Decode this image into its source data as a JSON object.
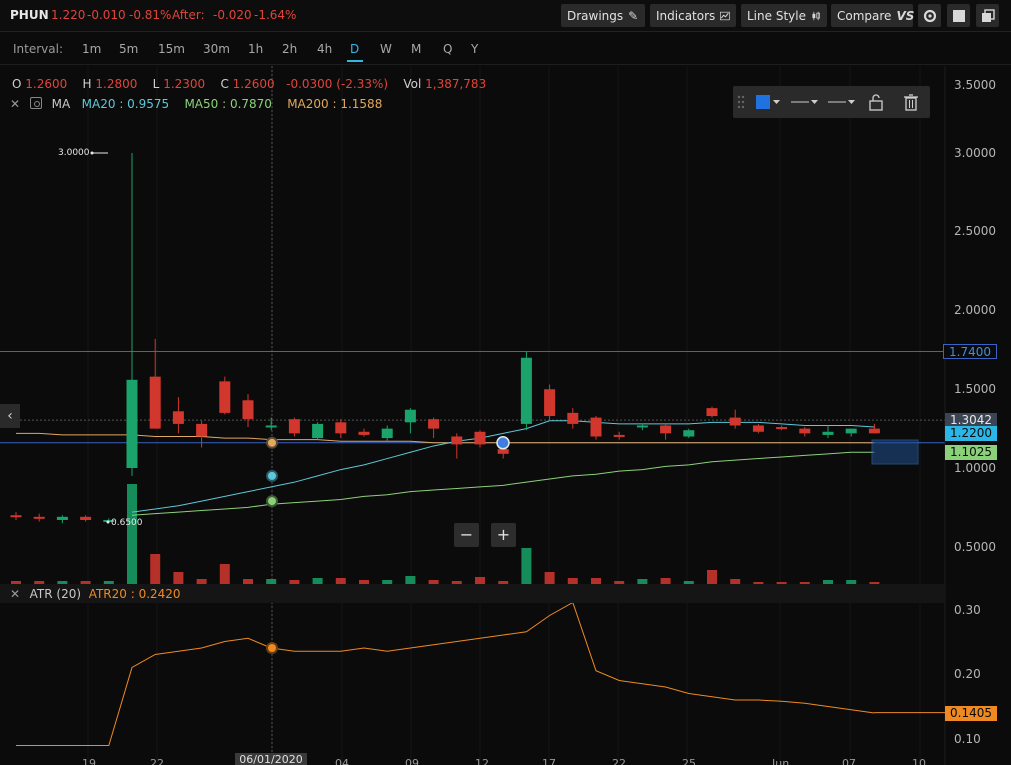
{
  "header": {
    "symbol": "PHUN",
    "last": "1.220",
    "change": "-0.010",
    "change_pct": "-0.81%",
    "after_label": "After:",
    "after_change": "-0.020",
    "after_pct": "-1.64%",
    "buttons": {
      "drawings": "Drawings",
      "indicators": "Indicators",
      "line_style": "Line Style",
      "compare": "Compare"
    },
    "icons": [
      "pencil-icon",
      "indicators-chart-icon",
      "candlestick-icon",
      "vs-icon",
      "settings-icon",
      "square-icon",
      "windows-icon"
    ]
  },
  "intervals": {
    "label": "Interval:",
    "items": [
      "1m",
      "5m",
      "15m",
      "30m",
      "1h",
      "2h",
      "4h",
      "D",
      "W",
      "M",
      "Q",
      "Y"
    ],
    "active": "D"
  },
  "ohlc": {
    "o_label": "O",
    "o": "1.2600",
    "h_label": "H",
    "h": "1.2800",
    "l_label": "L",
    "l": "1.2300",
    "c_label": "C",
    "c": "1.2600",
    "chg": "-0.0300 (-2.33%)",
    "vol_label": "Vol",
    "vol": "1,387,783"
  },
  "ma_legend": {
    "name": "MA",
    "ma20": "MA20 : 0.9575",
    "ma50": "MA50 : 0.7870",
    "ma200": "MA200 : 1.1588"
  },
  "atr_legend": {
    "name": "ATR (20)",
    "atr20": "ATR20 : 0.2420"
  },
  "colors": {
    "up": "#1aa36a",
    "down": "#d2372e",
    "ma20": "#5ec7d9",
    "ma50": "#8bd17a",
    "ma200": "#e0a860",
    "atr": "#ef8a22",
    "hline": "#3a63c4"
  },
  "price_axis": {
    "labels": [
      "3.5000",
      "3.0000",
      "2.5000",
      "2.0000",
      "1.5000",
      "1.0000",
      "0.5000"
    ]
  },
  "atr_axis": {
    "labels": [
      "0.30",
      "0.20",
      "0.10"
    ]
  },
  "price_tags": {
    "hline": "1.7400",
    "crosshair": "1.3042",
    "last": "1.2200",
    "ma": "1.1025",
    "atr": "0.1405"
  },
  "point_labels": {
    "high": "3.0000",
    "low": "0.6500"
  },
  "x_axis": {
    "labels": [
      "19",
      "22",
      "04",
      "09",
      "12",
      "17",
      "22",
      "25",
      "Jun",
      "07",
      "10"
    ],
    "cursor_date": "06/01/2020"
  },
  "zoom": {
    "minus": "−",
    "plus": "+"
  },
  "chart_data": {
    "type": "candlestick",
    "ylim": [
      0.3,
      3.6
    ],
    "hline": 1.74,
    "candles": [
      {
        "o": 0.7,
        "h": 0.72,
        "l": 0.67,
        "c": 0.69
      },
      {
        "o": 0.69,
        "h": 0.71,
        "l": 0.66,
        "c": 0.68
      },
      {
        "o": 0.67,
        "h": 0.7,
        "l": 0.65,
        "c": 0.69
      },
      {
        "o": 0.69,
        "h": 0.7,
        "l": 0.66,
        "c": 0.67
      },
      {
        "o": 0.66,
        "h": 0.68,
        "l": 0.65,
        "c": 0.67
      },
      {
        "o": 1.0,
        "h": 3.0,
        "l": 0.95,
        "c": 1.56
      },
      {
        "o": 1.58,
        "h": 1.82,
        "l": 1.25,
        "c": 1.25
      },
      {
        "o": 1.36,
        "h": 1.45,
        "l": 1.22,
        "c": 1.28
      },
      {
        "o": 1.28,
        "h": 1.3,
        "l": 1.13,
        "c": 1.2
      },
      {
        "o": 1.55,
        "h": 1.58,
        "l": 1.34,
        "c": 1.35
      },
      {
        "o": 1.43,
        "h": 1.47,
        "l": 1.26,
        "c": 1.31
      },
      {
        "o": 1.27,
        "h": 1.32,
        "l": 1.24,
        "c": 1.27
      },
      {
        "o": 1.31,
        "h": 1.32,
        "l": 1.2,
        "c": 1.22
      },
      {
        "o": 1.19,
        "h": 1.29,
        "l": 1.18,
        "c": 1.28
      },
      {
        "o": 1.29,
        "h": 1.31,
        "l": 1.19,
        "c": 1.22
      },
      {
        "o": 1.23,
        "h": 1.25,
        "l": 1.2,
        "c": 1.21
      },
      {
        "o": 1.19,
        "h": 1.27,
        "l": 1.17,
        "c": 1.25
      },
      {
        "o": 1.29,
        "h": 1.38,
        "l": 1.22,
        "c": 1.37
      },
      {
        "o": 1.31,
        "h": 1.32,
        "l": 1.19,
        "c": 1.25
      },
      {
        "o": 1.2,
        "h": 1.22,
        "l": 1.06,
        "c": 1.15
      },
      {
        "o": 1.23,
        "h": 1.24,
        "l": 1.13,
        "c": 1.15
      },
      {
        "o": 1.12,
        "h": 1.15,
        "l": 1.06,
        "c": 1.09
      },
      {
        "o": 1.28,
        "h": 1.74,
        "l": 1.24,
        "c": 1.7
      },
      {
        "o": 1.5,
        "h": 1.53,
        "l": 1.3,
        "c": 1.33
      },
      {
        "o": 1.35,
        "h": 1.38,
        "l": 1.25,
        "c": 1.28
      },
      {
        "o": 1.32,
        "h": 1.33,
        "l": 1.18,
        "c": 1.2
      },
      {
        "o": 1.21,
        "h": 1.23,
        "l": 1.18,
        "c": 1.2
      },
      {
        "o": 1.26,
        "h": 1.28,
        "l": 1.24,
        "c": 1.27
      },
      {
        "o": 1.27,
        "h": 1.28,
        "l": 1.18,
        "c": 1.22
      },
      {
        "o": 1.2,
        "h": 1.25,
        "l": 1.19,
        "c": 1.24
      },
      {
        "o": 1.38,
        "h": 1.39,
        "l": 1.32,
        "c": 1.33
      },
      {
        "o": 1.32,
        "h": 1.37,
        "l": 1.25,
        "c": 1.27
      },
      {
        "o": 1.27,
        "h": 1.28,
        "l": 1.22,
        "c": 1.23
      },
      {
        "o": 1.26,
        "h": 1.27,
        "l": 1.24,
        "c": 1.25
      },
      {
        "o": 1.25,
        "h": 1.26,
        "l": 1.2,
        "c": 1.22
      },
      {
        "o": 1.21,
        "h": 1.27,
        "l": 1.19,
        "c": 1.23
      },
      {
        "o": 1.22,
        "h": 1.25,
        "l": 1.2,
        "c": 1.25
      },
      {
        "o": 1.25,
        "h": 1.28,
        "l": 1.22,
        "c": 1.22
      }
    ],
    "ma20": [
      null,
      null,
      null,
      null,
      null,
      0.72,
      0.74,
      0.76,
      0.79,
      0.82,
      0.85,
      0.88,
      0.91,
      0.95,
      0.99,
      1.02,
      1.06,
      1.1,
      1.14,
      1.17,
      1.19,
      1.22,
      1.25,
      1.3,
      1.3,
      1.29,
      1.28,
      1.28,
      1.28,
      1.28,
      1.29,
      1.29,
      1.29,
      1.28,
      1.27,
      1.27,
      1.27,
      1.26
    ],
    "ma50": [
      null,
      null,
      null,
      null,
      null,
      0.7,
      0.71,
      0.72,
      0.73,
      0.74,
      0.75,
      0.77,
      0.78,
      0.79,
      0.8,
      0.82,
      0.83,
      0.85,
      0.86,
      0.87,
      0.88,
      0.89,
      0.91,
      0.93,
      0.95,
      0.96,
      0.98,
      0.99,
      1.01,
      1.02,
      1.04,
      1.05,
      1.06,
      1.07,
      1.08,
      1.09,
      1.1,
      1.1
    ],
    "ma200": [
      1.22,
      1.22,
      1.21,
      1.21,
      1.21,
      1.21,
      1.2,
      1.2,
      1.2,
      1.19,
      1.19,
      1.18,
      1.18,
      1.18,
      1.17,
      1.17,
      1.17,
      1.17,
      1.16,
      1.16,
      1.16,
      1.16,
      1.16,
      1.16,
      1.16,
      1.16,
      1.16,
      1.16,
      1.16,
      1.16,
      1.16,
      1.16,
      1.16,
      1.16,
      1.16,
      1.16,
      1.16,
      1.16
    ],
    "volume": [
      0.3,
      0.3,
      0.3,
      0.3,
      0.3,
      10,
      3,
      1.2,
      0.5,
      2,
      0.5,
      0.5,
      0.4,
      0.6,
      0.6,
      0.4,
      0.4,
      0.8,
      0.4,
      0.3,
      0.7,
      0.3,
      3.6,
      1.2,
      0.6,
      0.6,
      0.3,
      0.5,
      0.6,
      0.3,
      1.4,
      0.5,
      0.2,
      0.2,
      0.2,
      0.4,
      0.4,
      0.2
    ],
    "atr_ylim": [
      0.08,
      0.33
    ],
    "atr": [
      0.09,
      0.09,
      0.09,
      0.09,
      0.09,
      0.21,
      0.23,
      0.235,
      0.24,
      0.25,
      0.255,
      0.24,
      0.235,
      0.235,
      0.235,
      0.24,
      0.235,
      0.24,
      0.245,
      0.25,
      0.255,
      0.26,
      0.265,
      0.29,
      0.31,
      0.205,
      0.19,
      0.185,
      0.18,
      0.17,
      0.165,
      0.16,
      0.16,
      0.158,
      0.155,
      0.15,
      0.145,
      0.14
    ]
  }
}
